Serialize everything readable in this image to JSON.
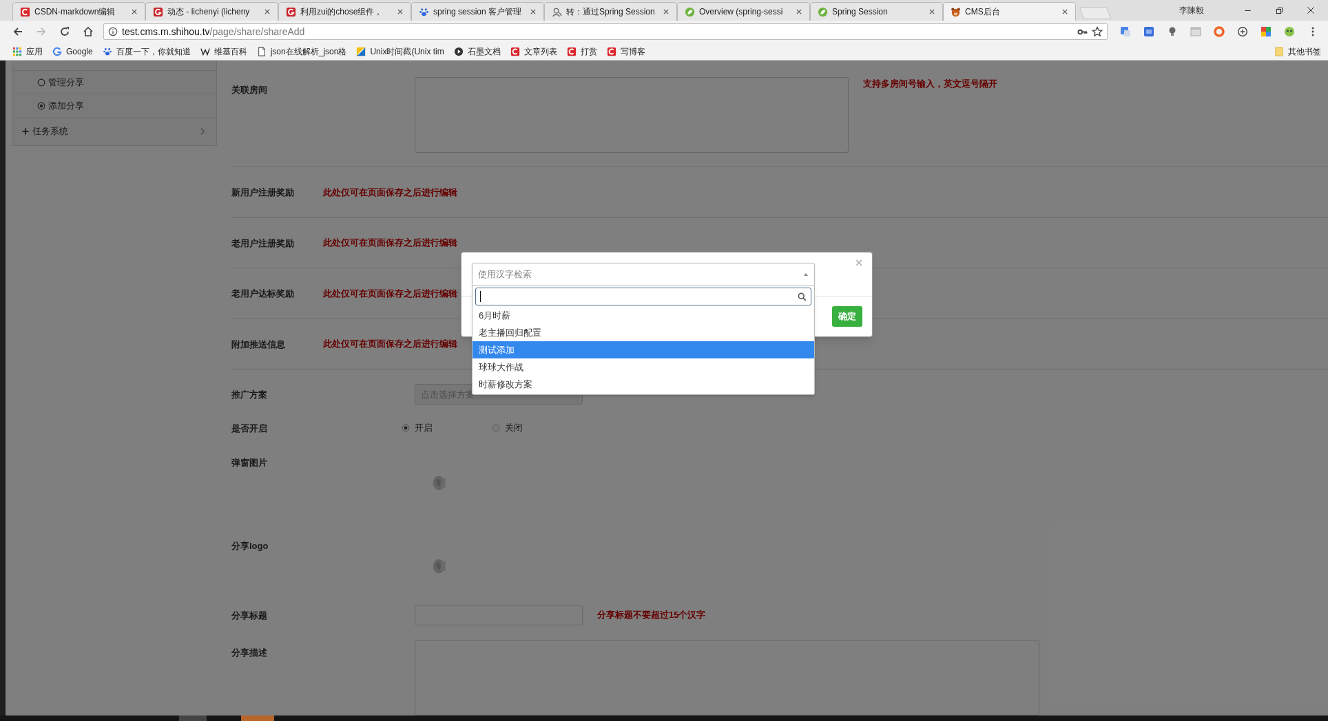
{
  "browser": {
    "tabs": [
      {
        "title": "CSDN-markdown编辑",
        "kind": "c-logo",
        "selected": false
      },
      {
        "title": "动态 - lichenyi (licheny",
        "kind": "g-logo",
        "selected": false
      },
      {
        "title": "利用zui的chose组件，",
        "kind": "g-logo",
        "selected": false
      },
      {
        "title": "spring session 客户管理",
        "kind": "paw",
        "selected": false
      },
      {
        "title": "转：通过Spring Session",
        "kind": "user",
        "selected": false
      },
      {
        "title": "Overview (spring-sessi",
        "kind": "leaf",
        "selected": false
      },
      {
        "title": "Spring Session",
        "kind": "leaf",
        "selected": false
      },
      {
        "title": "CMS后台",
        "kind": "bear",
        "selected": true
      }
    ],
    "user": "李陳毅",
    "address": {
      "host": "test.cms.m.shihou.tv",
      "path": "/page/share/shareAdd"
    },
    "bookmarks": [
      {
        "label": "应用",
        "kind": "grid"
      },
      {
        "label": "Google",
        "kind": "google"
      },
      {
        "label": "百度一下，你就知道",
        "kind": "paw"
      },
      {
        "label": "维基百科",
        "kind": "w"
      },
      {
        "label": "json在线解析_json格",
        "kind": "page"
      },
      {
        "label": "Unix时间戳(Unix tim",
        "kind": "split"
      },
      {
        "label": "石墨文档",
        "kind": "play"
      },
      {
        "label": "文章列表",
        "kind": "c-logo"
      },
      {
        "label": "打赏",
        "kind": "c-logo"
      },
      {
        "label": "写博客",
        "kind": "c-logo"
      }
    ],
    "other_bookmarks": "其他书签"
  },
  "sidebar": {
    "items": [
      {
        "label": "管理分享",
        "kind": "radio",
        "selected": false
      },
      {
        "label": "添加分享",
        "kind": "radio",
        "selected": true
      },
      {
        "label": "任务系统",
        "kind": "group",
        "expanded": false
      }
    ]
  },
  "form": {
    "rows": [
      {
        "label": "关联房间",
        "kind": "textarea",
        "hint": "支持多房间号输入，英文逗号隔开"
      },
      {
        "label": "新用户注册奖励",
        "kind": "note",
        "note": "此处仅可在页面保存之后进行编辑"
      },
      {
        "label": "老用户注册奖励",
        "kind": "note",
        "note": "此处仅可在页面保存之后进行编辑"
      },
      {
        "label": "老用户达标奖励",
        "kind": "note",
        "note": "此处仅可在页面保存之后进行编辑"
      },
      {
        "label": "附加推送信息",
        "kind": "note",
        "note": "此处仅可在页面保存之后进行编辑"
      },
      {
        "label": "推广方案",
        "kind": "picker",
        "placeholder": "点击选择方案"
      },
      {
        "label": "是否开启",
        "kind": "radios",
        "options": [
          {
            "label": "开启",
            "selected": true
          },
          {
            "label": "关闭",
            "selected": false
          }
        ]
      },
      {
        "label": "弹窗图片",
        "kind": "image"
      },
      {
        "label": "分享logo",
        "kind": "image"
      },
      {
        "label": "分享标题",
        "kind": "input",
        "hint": "分享标题不要超过15个汉字"
      },
      {
        "label": "分享描述",
        "kind": "textarea_wide"
      }
    ]
  },
  "modal": {
    "select": {
      "placeholder": "使用汉字检索",
      "expanded": true
    },
    "options": [
      {
        "label": "6月时薪",
        "selected": false
      },
      {
        "label": "老主播回归配置",
        "selected": false
      },
      {
        "label": "测试添加",
        "selected": true
      },
      {
        "label": "球球大作战",
        "selected": false
      },
      {
        "label": "时薪修改方案",
        "selected": false
      }
    ],
    "confirm": "确定"
  }
}
